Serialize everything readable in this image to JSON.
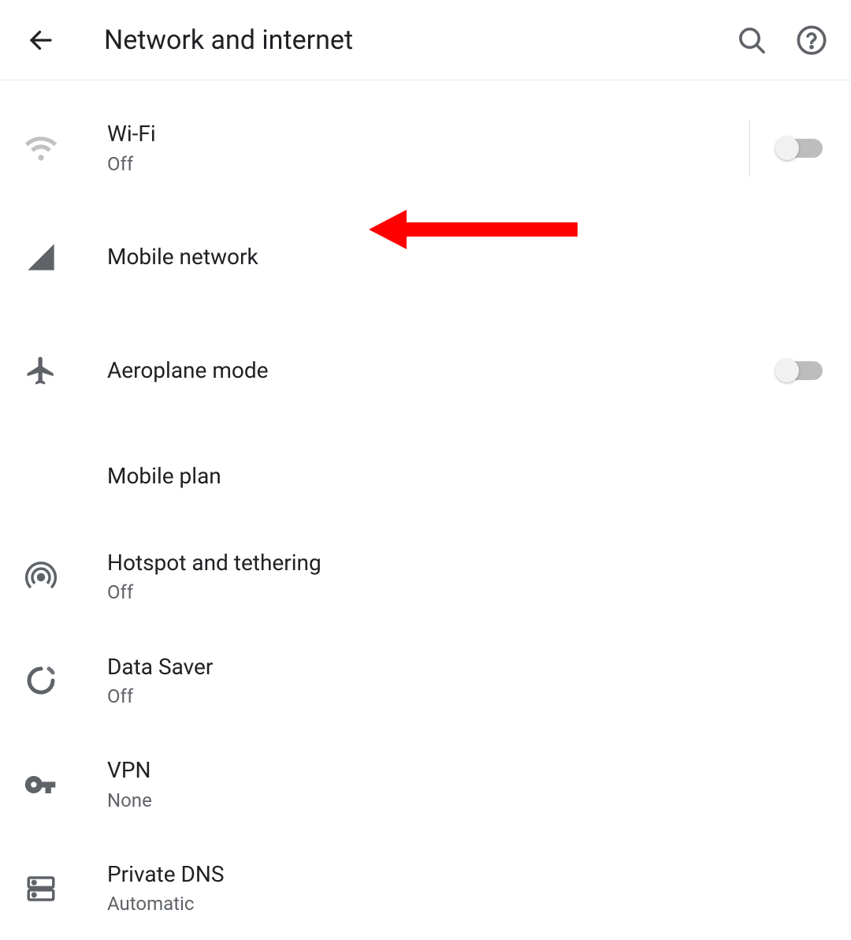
{
  "header": {
    "title": "Network and internet"
  },
  "items": [
    {
      "title": "Wi-Fi",
      "subtitle": "Off",
      "toggle": false,
      "hasDivider": true
    },
    {
      "title": "Mobile network",
      "subtitle": null,
      "toggle": null
    },
    {
      "title": "Aeroplane mode",
      "subtitle": null,
      "toggle": false
    },
    {
      "title": "Mobile plan",
      "subtitle": null,
      "toggle": null
    },
    {
      "title": "Hotspot and tethering",
      "subtitle": "Off",
      "toggle": null
    },
    {
      "title": "Data Saver",
      "subtitle": "Off",
      "toggle": null
    },
    {
      "title": "VPN",
      "subtitle": "None",
      "toggle": null
    },
    {
      "title": "Private DNS",
      "subtitle": "Automatic",
      "toggle": null
    }
  ]
}
